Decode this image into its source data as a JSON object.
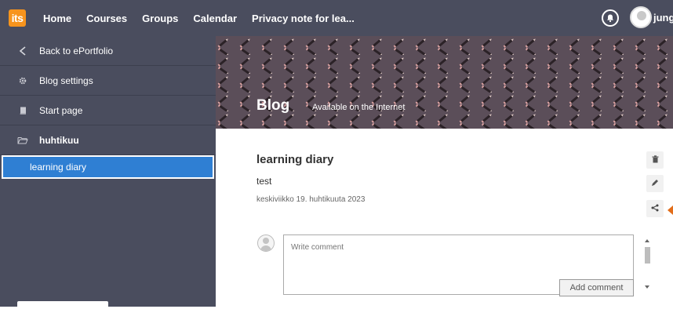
{
  "topbar": {
    "logo_text": "its",
    "nav": [
      "Home",
      "Courses",
      "Groups",
      "Calendar",
      "Privacy note for lea..."
    ],
    "user_name": "jung",
    "icons": {
      "notifications": "bell-icon",
      "user": "avatar-icon"
    }
  },
  "sidebar": {
    "back_label": "Back to ePortfolio",
    "settings_label": "Blog settings",
    "start_label": "Start page",
    "folder_label": "huhtikuu",
    "active_label": "learning diary",
    "icons": {
      "back": "chevron-left-icon",
      "settings": "gear-icon",
      "start": "book-icon",
      "folder": "folder-open-icon"
    }
  },
  "banner": {
    "title": "Blog",
    "subtitle": "Available on the Internet"
  },
  "post": {
    "title": "learning diary",
    "body": "test",
    "date": "keskiviikko 19. huhtikuuta 2023"
  },
  "actions": {
    "icons": [
      "trash-icon",
      "pencil-icon",
      "share-icon"
    ]
  },
  "comment": {
    "placeholder": "Write comment",
    "submit_label": "Add comment"
  },
  "colors": {
    "nav_bg": "#4a4d5e",
    "active_item": "#2f7fd3",
    "logo_orange": "#f7941d",
    "accent_pointer": "#e26d1a"
  }
}
